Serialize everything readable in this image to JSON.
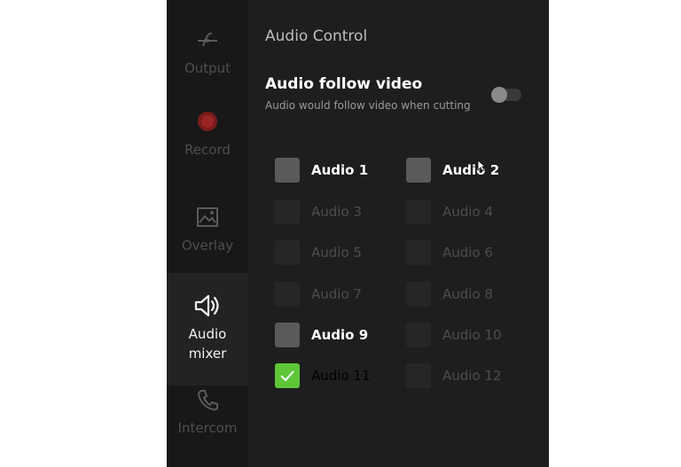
{
  "sidebar": {
    "items": [
      {
        "label": "Output",
        "icon": "output-icon"
      },
      {
        "label": "Record",
        "icon": "record-icon"
      },
      {
        "label": "Overlay",
        "icon": "overlay-icon"
      },
      {
        "label": "Audio\nmixer",
        "icon": "speaker-icon",
        "active": true
      },
      {
        "label": "Intercom",
        "icon": "phone-icon"
      }
    ]
  },
  "panel": {
    "title": "Audio Control",
    "follow_video": {
      "title": "Audio follow video",
      "description": "Audio would follow video when cutting",
      "enabled": false
    },
    "channels": [
      {
        "label": "Audio 1",
        "state": "enabled"
      },
      {
        "label": "Audio 2",
        "state": "enabled"
      },
      {
        "label": "Audio 3",
        "state": "disabled"
      },
      {
        "label": "Audio 4",
        "state": "disabled"
      },
      {
        "label": "Audio 5",
        "state": "disabled"
      },
      {
        "label": "Audio 6",
        "state": "disabled"
      },
      {
        "label": "Audio 7",
        "state": "disabled"
      },
      {
        "label": "Audio 8",
        "state": "disabled"
      },
      {
        "label": "Audio 9",
        "state": "enabled"
      },
      {
        "label": "Audio 10",
        "state": "disabled"
      },
      {
        "label": "Audio 11",
        "state": "checked"
      },
      {
        "label": "Audio 12",
        "state": "disabled"
      }
    ]
  },
  "colors": {
    "accent_green": "#5fc63a",
    "record_red": "#7a1c1c",
    "background": "#1e1e1e"
  }
}
